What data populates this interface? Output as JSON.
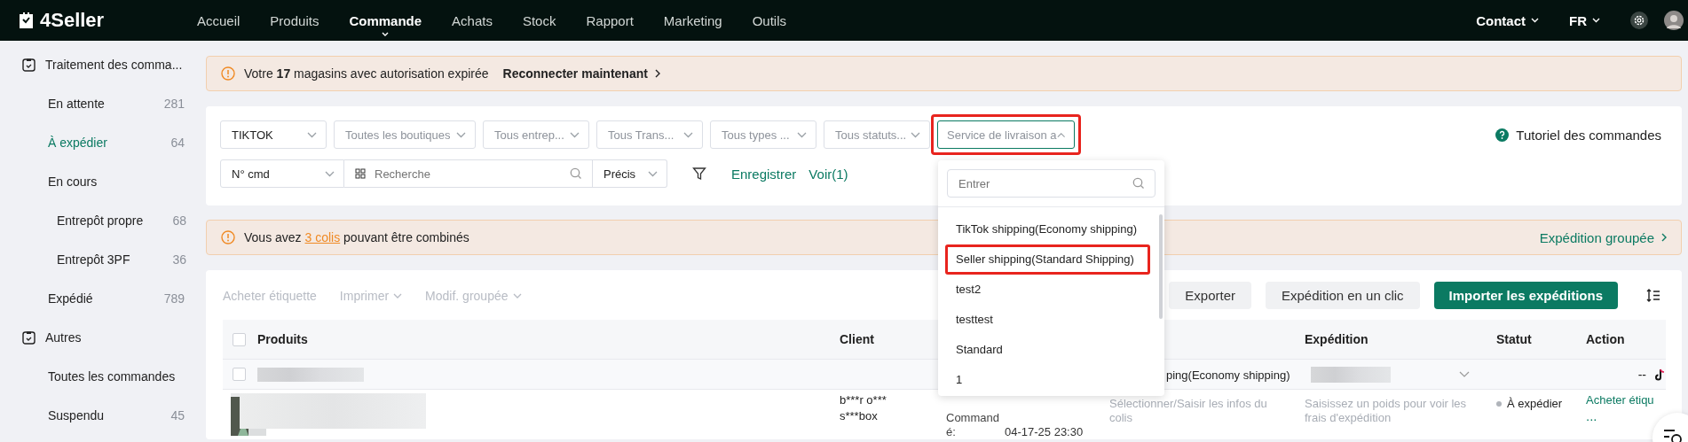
{
  "topbar": {
    "logo": "4Seller",
    "nav": [
      {
        "label": "Accueil",
        "selected": false
      },
      {
        "label": "Produits",
        "selected": false
      },
      {
        "label": "Commande",
        "selected": true
      },
      {
        "label": "Achats",
        "selected": false
      },
      {
        "label": "Stock",
        "selected": false
      },
      {
        "label": "Rapport",
        "selected": false
      },
      {
        "label": "Marketing",
        "selected": false
      },
      {
        "label": "Outils",
        "selected": false
      }
    ],
    "contact": "Contact",
    "language": "FR"
  },
  "sidebar": {
    "groups": [
      {
        "label": "Traitement des comma...",
        "items": [
          {
            "label": "En attente",
            "count": "281",
            "selected": false
          },
          {
            "label": "À expédier",
            "count": "64",
            "selected": true
          },
          {
            "label": "En cours",
            "selected": false,
            "children": [
              {
                "label": "Entrepôt propre",
                "count": "68",
                "selected": false
              },
              {
                "label": "Entrepôt 3PF",
                "count": "36",
                "selected": false
              }
            ]
          },
          {
            "label": "Expédié",
            "count": "789",
            "selected": false
          }
        ]
      },
      {
        "label": "Autres",
        "items": [
          {
            "label": "Toutes les commandes",
            "selected": false
          },
          {
            "label": "Suspendu",
            "count": "45",
            "selected": false
          }
        ]
      }
    ]
  },
  "alert": {
    "text": "Votre **17** magasins avec autorisation expirée",
    "link": "Reconnecter maintenant"
  },
  "filters": {
    "selects": [
      {
        "value": "TIKTOK",
        "open": false,
        "highlighted": false
      },
      {
        "placeholder": "Toutes les boutiques",
        "open": false,
        "highlighted": false
      },
      {
        "placeholder": "Tous entrep...",
        "open": false,
        "highlighted": false
      },
      {
        "placeholder": "Tous Trans...",
        "open": false,
        "highlighted": false
      },
      {
        "placeholder": "Tous types ...",
        "open": false,
        "highlighted": false
      },
      {
        "placeholder": "Tous statuts...",
        "open": false,
        "highlighted": false
      },
      {
        "placeholder": "Service de livraison a",
        "open": true,
        "highlighted": true
      }
    ],
    "order_field": "N° cmd",
    "search_placeholder": "Recherche",
    "match": "Précis",
    "save": "Enregistrer",
    "view": "Voir(1)",
    "help": "Tutoriel des commandes"
  },
  "dropdown": {
    "search_placeholder": "Entrer",
    "options": [
      {
        "label": "TikTok shipping(Economy shipping)",
        "highlighted": false
      },
      {
        "label": "Seller shipping(Standard Shipping)",
        "highlighted": true
      },
      {
        "label": "test2",
        "highlighted": false
      },
      {
        "label": "testtest",
        "highlighted": false
      },
      {
        "label": "Standard",
        "highlighted": false
      },
      {
        "label": "1",
        "highlighted": false
      }
    ]
  },
  "notice": {
    "before": "Vous avez",
    "link": "3 colis",
    "after": "pouvant être combinés",
    "action": "Expédition groupée"
  },
  "toolbar": {
    "menus": [
      {
        "label": "Acheter étiquette",
        "has_menu": false,
        "disabled": true
      },
      {
        "label": "Imprimer",
        "has_menu": true,
        "disabled": true
      },
      {
        "label": "Modif. groupée",
        "has_menu": true,
        "disabled": true
      }
    ],
    "buttons": [
      {
        "label": "Exporter",
        "primary": false
      },
      {
        "label": "Expédition en un clic",
        "primary": false
      },
      {
        "label": "Importer les expéditions",
        "primary": true
      }
    ]
  },
  "table": {
    "select_all_checked": false,
    "columns": [
      "Produits",
      "Client",
      "Expédition",
      "Statut",
      "Action"
    ],
    "rows": [
      {
        "kind": "group",
        "checked": false,
        "shipping": "ping(Economy shipping)",
        "action": "--"
      },
      {
        "kind": "order",
        "client": [
          "b***r o***",
          "s***box"
        ],
        "date_label": "Commandé:",
        "date": "04-17-25 23:30",
        "logistics": "Sélectionner/Saisir les infos du colis",
        "shipping_hint": "Saisissez un poids pour voir les frais d'expédition",
        "status": "À expédier",
        "action": "Acheter étiqu",
        "more": "..."
      }
    ]
  }
}
